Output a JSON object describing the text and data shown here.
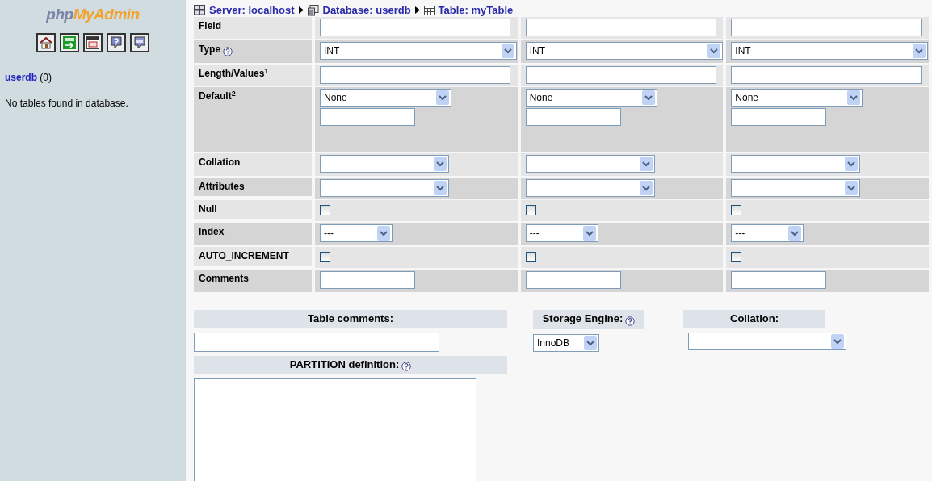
{
  "sidebar": {
    "logo": {
      "prefix": "php",
      "name": "MyAdmin"
    },
    "toolbar": [
      {
        "kind": "home"
      },
      {
        "kind": "exit"
      },
      {
        "kind": "sql-window"
      },
      {
        "kind": "help"
      },
      {
        "kind": "sql-help"
      }
    ],
    "database": {
      "name": "userdb",
      "count": "(0)"
    },
    "message": "No tables found in database."
  },
  "breadcrumb": [
    {
      "kind": "server",
      "label": "Server: localhost"
    },
    {
      "kind": "database",
      "label": "Database: userdb"
    },
    {
      "kind": "table",
      "label": "Table: myTable"
    }
  ],
  "rows": [
    {
      "kind": "field",
      "label": "Field"
    },
    {
      "kind": "type",
      "label": "Type",
      "help": true
    },
    {
      "kind": "length",
      "label": "Length/Values$^{1}$"
    },
    {
      "kind": "default",
      "label": "Default$^{2}$"
    },
    {
      "kind": "collation",
      "label": "Collation"
    },
    {
      "kind": "attributes",
      "label": "Attributes"
    },
    {
      "kind": "null",
      "label": "Null"
    },
    {
      "kind": "index",
      "label": "Index"
    },
    {
      "kind": "auto_increment",
      "label": "AUTO_INCREMENT"
    },
    {
      "kind": "comments",
      "label": "Comments"
    }
  ],
  "columns": [
    {
      "type": "INT",
      "default": "None",
      "null": false,
      "index": "---",
      "auto_increment": false
    },
    {
      "type": "INT",
      "default": "None",
      "null": false,
      "index": "---",
      "auto_increment": false
    },
    {
      "type": "INT",
      "default": "None",
      "null": false,
      "index": "---",
      "auto_increment": false
    }
  ],
  "table_comments": {
    "label": "Table comments:"
  },
  "partition": {
    "label": "PARTITION definition:",
    "help": true
  },
  "storage_engine": {
    "label": "Storage Engine:",
    "help": true,
    "value": "InnoDB"
  },
  "collation": {
    "label": "Collation:"
  }
}
